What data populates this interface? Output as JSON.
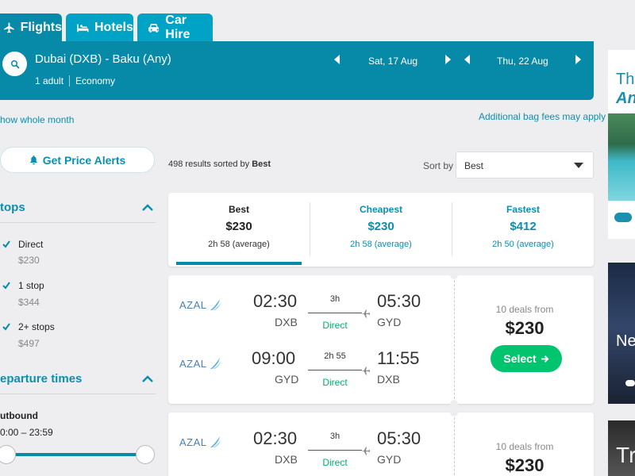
{
  "tabs": [
    {
      "label": "Flights",
      "icon": "plane-icon"
    },
    {
      "label": "Hotels",
      "icon": "bed-icon"
    },
    {
      "label": "Car Hire",
      "icon": "car-icon"
    }
  ],
  "search": {
    "route": "Dubai (DXB) - Baku (Any)",
    "passengers": "1 adult",
    "cabin": "Economy",
    "depart_date": "Sat, 17 Aug",
    "return_date": "Thu, 22 Aug"
  },
  "links": {
    "whole_month": "how whole month",
    "bag_fees": "Additional bag fees may apply"
  },
  "sidebar": {
    "alerts_label": "Get Price Alerts",
    "stops_title": "tops",
    "stops": [
      {
        "label": "Direct",
        "price": "$230",
        "checked": true
      },
      {
        "label": "1 stop",
        "price": "$344",
        "checked": true
      },
      {
        "label": "2+ stops",
        "price": "$497",
        "checked": true
      }
    ],
    "departure_title": "eparture times",
    "outbound_label": "utbound",
    "outbound_range": "0:00 – 23:59"
  },
  "results": {
    "count_text": "498 results sorted by",
    "sort_key": "Best",
    "sort_by_label": "Sort by",
    "sort_value": "Best"
  },
  "sort_tabs": [
    {
      "title": "Best",
      "price": "$230",
      "duration": "2h 58 (average)"
    },
    {
      "title": "Cheapest",
      "price": "$230",
      "duration": "2h 58 (average)"
    },
    {
      "title": "Fastest",
      "price": "$412",
      "duration": "2h 50 (average)"
    }
  ],
  "flights": [
    {
      "legs": [
        {
          "airline": "AZAL",
          "dep_time": "02:30",
          "dep_code": "DXB",
          "duration": "3h",
          "stops": "Direct",
          "arr_time": "05:30",
          "arr_code": "GYD"
        },
        {
          "airline": "AZAL",
          "dep_time": "09:00",
          "dep_code": "GYD",
          "duration": "2h 55",
          "stops": "Direct",
          "arr_time": "11:55",
          "arr_code": "DXB"
        }
      ],
      "deals": "10 deals from",
      "price": "$230",
      "select_label": "Select"
    },
    {
      "legs": [
        {
          "airline": "AZAL",
          "dep_time": "02:30",
          "dep_code": "DXB",
          "duration": "3h",
          "stops": "Direct",
          "arr_time": "05:30",
          "arr_code": "GYD"
        }
      ],
      "deals": "10 deals from",
      "price": "$230"
    }
  ],
  "ads": [
    {
      "line1": "The",
      "line2": "And"
    },
    {
      "line1": "Ne"
    },
    {
      "line1": "Tr"
    }
  ],
  "colors": {
    "primary": "#0789a8",
    "tab": "#00a3c6",
    "link": "#0a8fb0",
    "cta": "#00c46e",
    "direct": "#00b26b",
    "page_bg": "#eeeef0"
  }
}
